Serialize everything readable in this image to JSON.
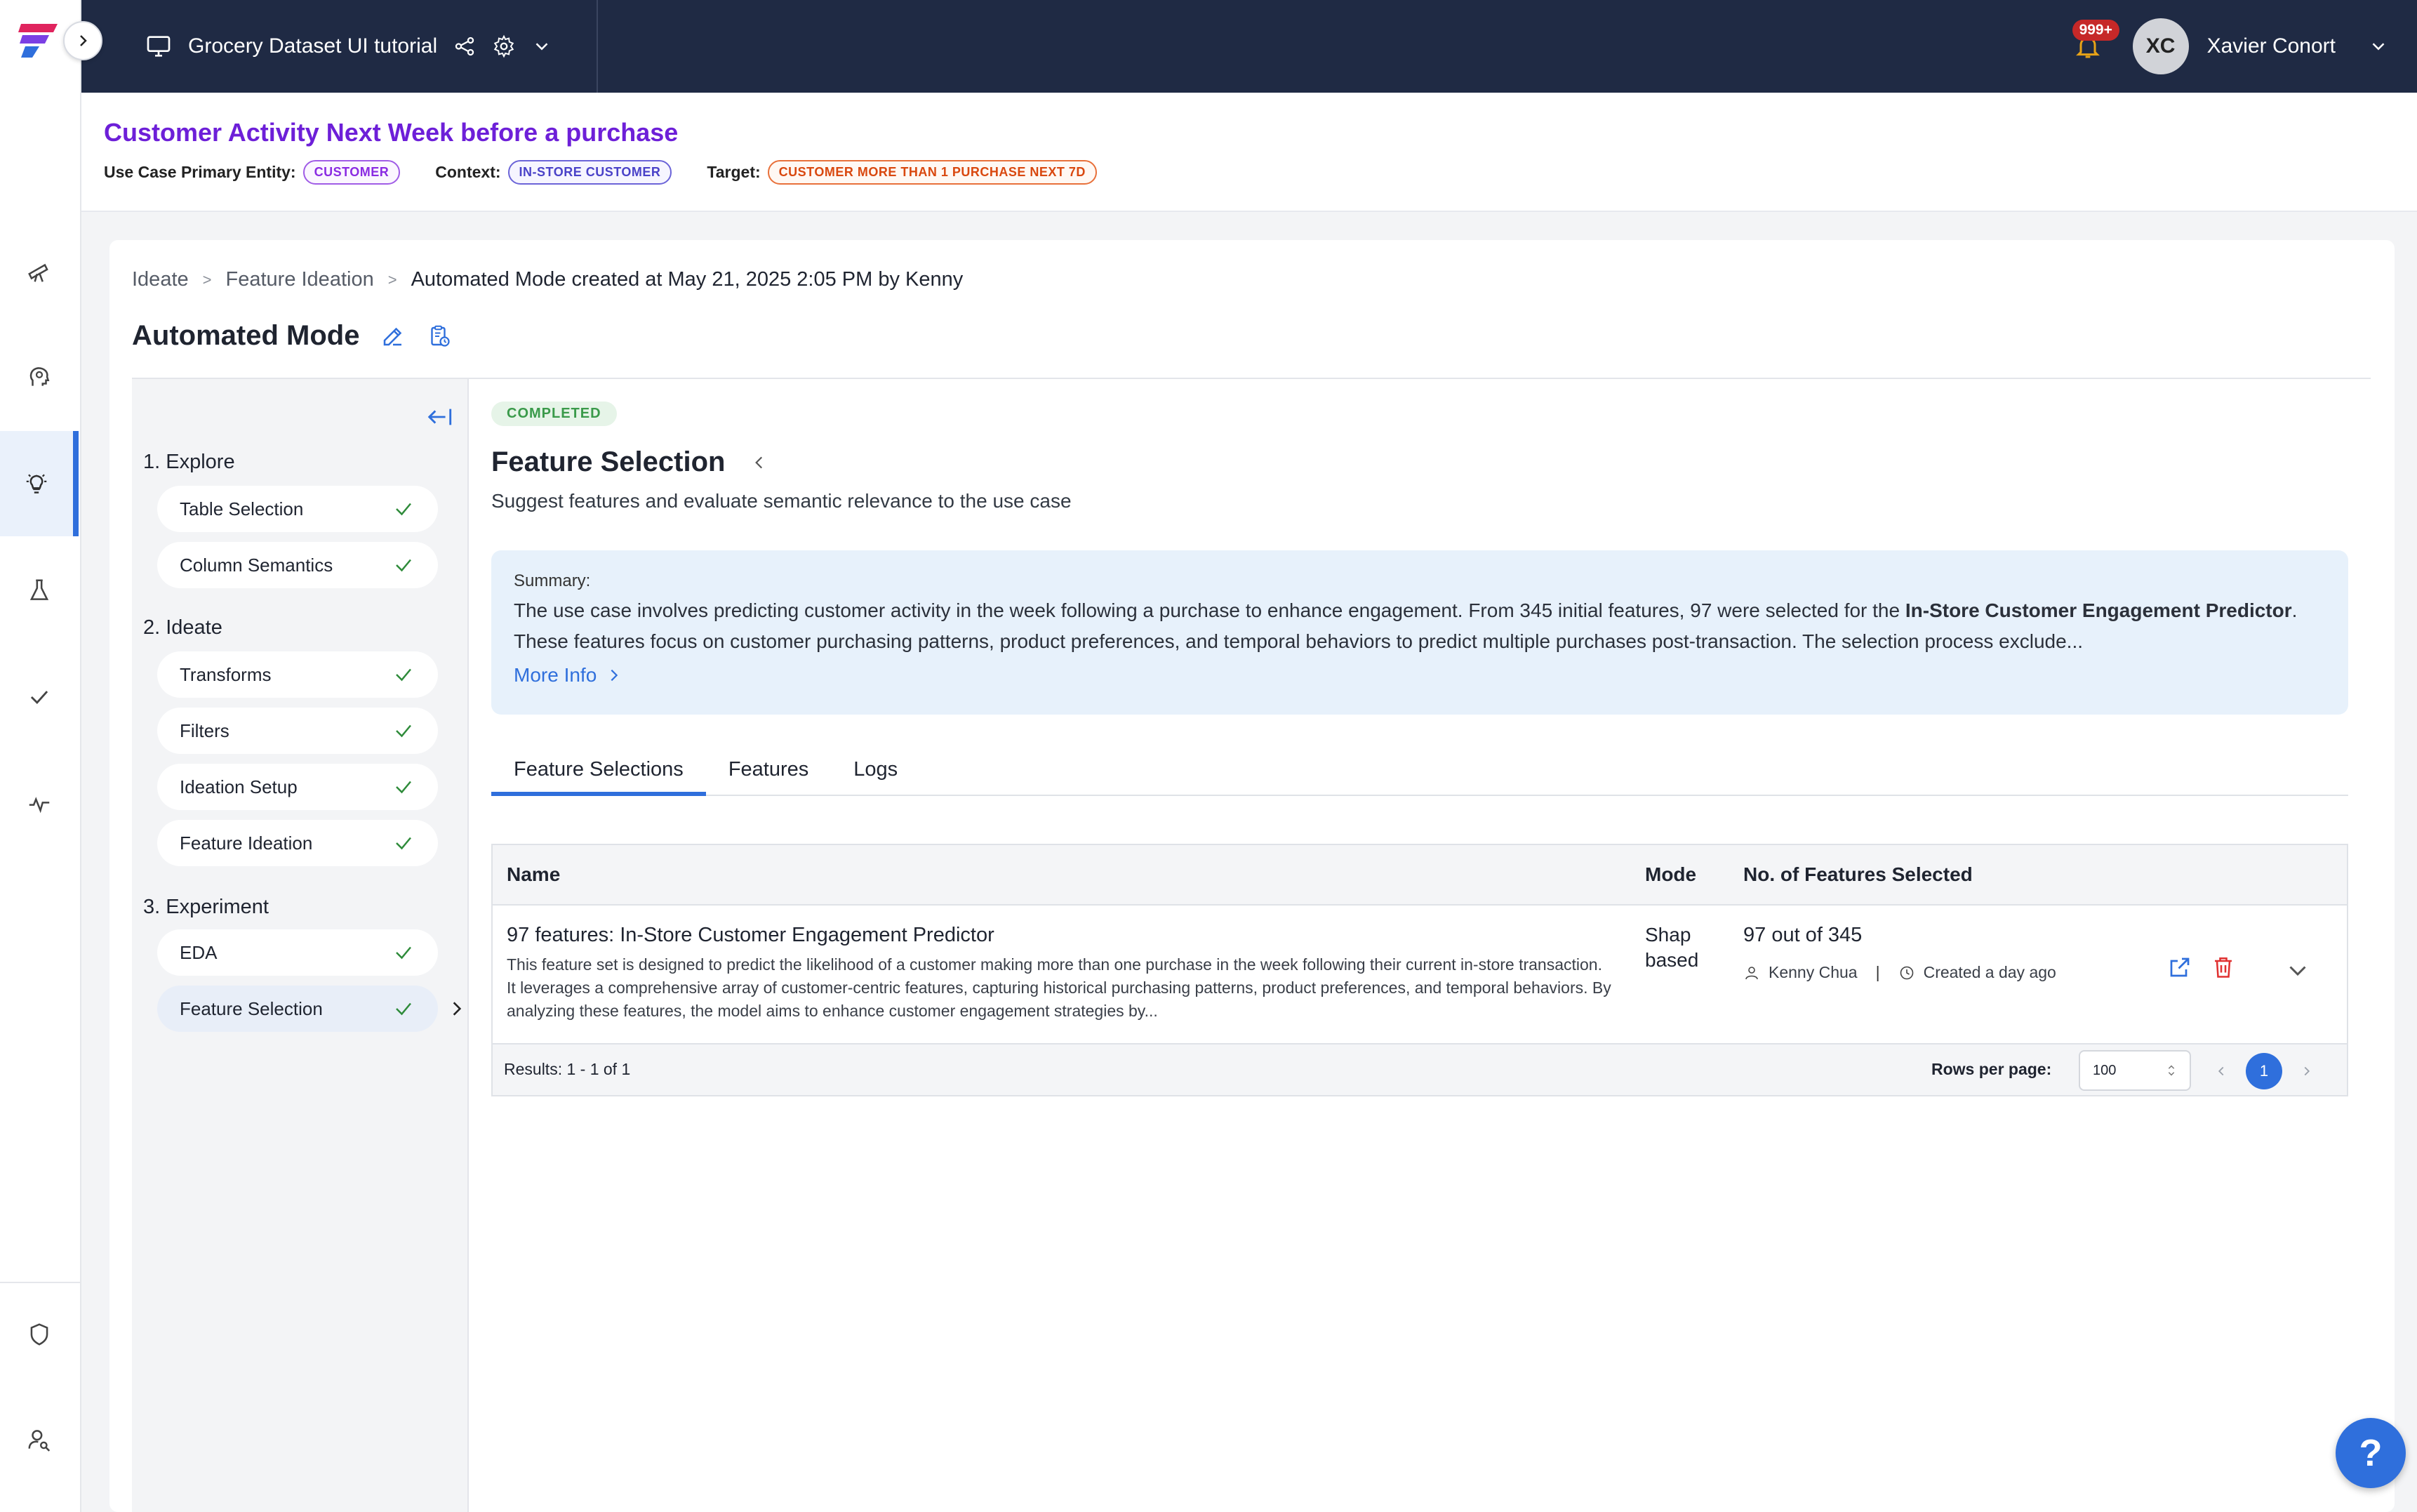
{
  "topbar": {
    "project_name": "Grocery Dataset UI tutorial",
    "notification_count": "999+",
    "avatar_initials": "XC",
    "user_name": "Xavier Conort"
  },
  "use_case": {
    "title": "Customer Activity Next Week before a purchase",
    "entity_label": "Use Case Primary Entity:",
    "entity_value": "CUSTOMER",
    "context_label": "Context:",
    "context_value": "IN-STORE CUSTOMER",
    "target_label": "Target:",
    "target_value": "CUSTOMER MORE THAN 1 PURCHASE NEXT 7D"
  },
  "breadcrumb": {
    "items": [
      "Ideate",
      "Feature Ideation"
    ],
    "current": "Automated Mode created at May 21, 2025 2:05 PM by Kenny",
    "separator": ">"
  },
  "page": {
    "title": "Automated Mode"
  },
  "steps": {
    "groups": [
      {
        "label": "1. Explore",
        "items": [
          {
            "label": "Table Selection"
          },
          {
            "label": "Column Semantics"
          }
        ]
      },
      {
        "label": "2. Ideate",
        "items": [
          {
            "label": "Transforms"
          },
          {
            "label": "Filters"
          },
          {
            "label": "Ideation Setup"
          },
          {
            "label": "Feature Ideation"
          }
        ]
      },
      {
        "label": "3. Experiment",
        "items": [
          {
            "label": "EDA"
          },
          {
            "label": "Feature Selection"
          }
        ]
      }
    ]
  },
  "content": {
    "status": "COMPLETED",
    "title": "Feature Selection",
    "subtitle": "Suggest features and evaluate semantic relevance to the use case",
    "summary_label": "Summary:",
    "summary_pre": "The use case involves predicting customer activity in the week following a purchase to enhance engagement. From 345 initial features, 97 were selected for the ",
    "summary_bold": "In-Store Customer Engagement Predictor",
    "summary_post": ". These features focus on customer purchasing patterns, product preferences, and temporal behaviors to predict multiple purchases post-transaction. The selection process exclude...",
    "more_info": "More Info",
    "tabs": [
      "Feature Selections",
      "Features",
      "Logs"
    ]
  },
  "table": {
    "headers": {
      "name": "Name",
      "mode": "Mode",
      "count": "No. of Features Selected"
    },
    "rows": [
      {
        "name": "97 features: In-Store Customer Engagement Predictor",
        "description": "This feature set is designed to predict the likelihood of a customer making more than one purchase in the week following their current in-store transaction. It leverages a comprehensive array of customer-centric features, capturing historical purchasing patterns, product preferences, and temporal behaviors. By analyzing these features, the model aims to enhance customer engagement strategies by...",
        "mode": "Shap based",
        "count": "97 out of 345",
        "author": "Kenny Chua",
        "created": "Created a day ago"
      }
    ],
    "footer": {
      "results": "Results: 1 - 1 of 1",
      "rows_per_page_label": "Rows per page:",
      "rows_per_page_value": "100",
      "current_page": "1"
    }
  },
  "help_label": "?",
  "colors": {
    "accent": "#2f6fdc",
    "topbar": "#1f2a44",
    "title_purple": "#6d1fd8",
    "success": "#2e8b3a"
  }
}
